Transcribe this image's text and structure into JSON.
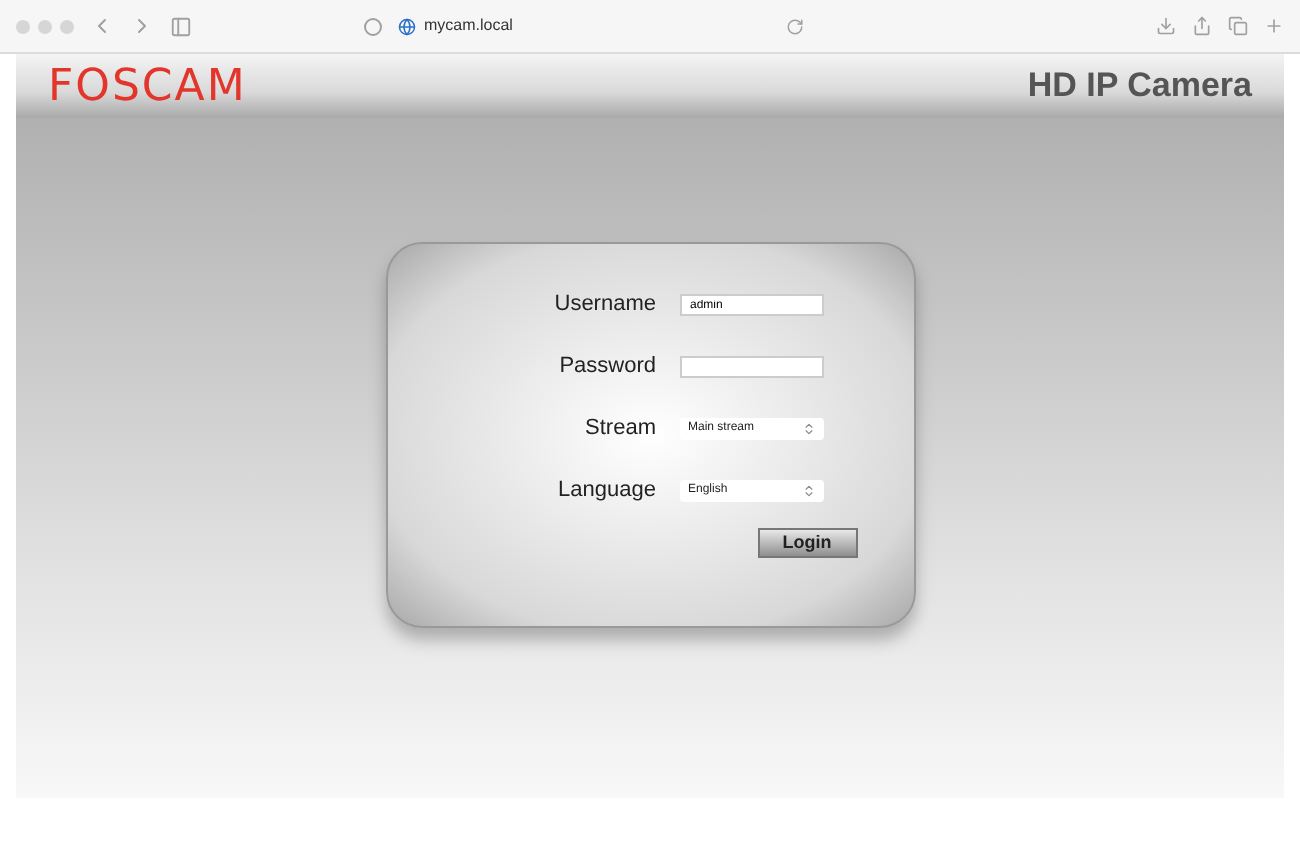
{
  "browser": {
    "address": "mycam.local"
  },
  "header": {
    "logo": "FOSCAM",
    "title": "HD IP Camera"
  },
  "login": {
    "fields": [
      {
        "kind": "text",
        "label": "Username",
        "value": "admin"
      },
      {
        "kind": "password",
        "label": "Password"
      },
      {
        "kind": "select",
        "label": "Stream",
        "value": "Main stream"
      },
      {
        "kind": "select",
        "label": "Language",
        "value": "English"
      }
    ],
    "button": "Login"
  }
}
